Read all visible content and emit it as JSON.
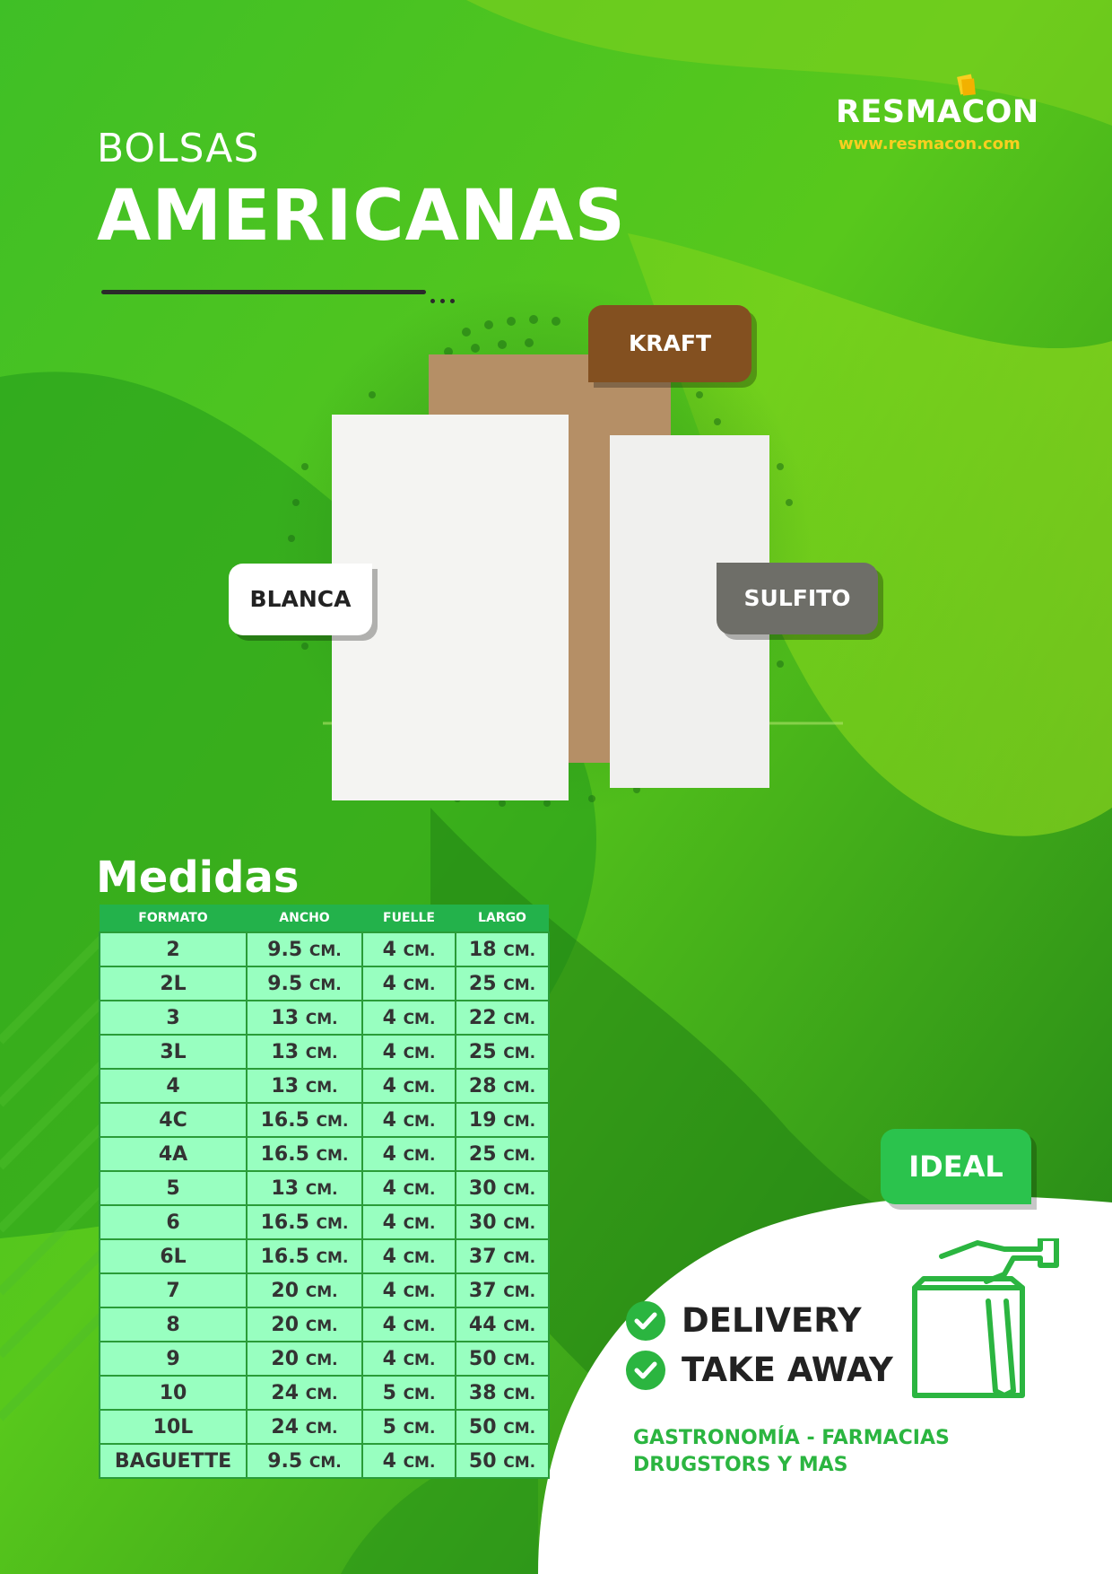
{
  "header": {
    "title_small": "BOLSAS",
    "title_big": "AMERICANAS"
  },
  "brand": {
    "name": "RESMACON",
    "url": "www.resmacon.com",
    "accent_color": "#f7cf20"
  },
  "bag_tags": {
    "kraft": "KRAFT",
    "blanca": "BLANCA",
    "sulfito": "SULFITO"
  },
  "medidas": {
    "title": "Medidas",
    "headers": [
      "FORMATO",
      "ANCHO",
      "FUELLE",
      "LARGO"
    ],
    "unit": "CM.",
    "rows": [
      {
        "formato": "2",
        "ancho": "9.5",
        "fuelle": "4",
        "largo": "18"
      },
      {
        "formato": "2L",
        "ancho": "9.5",
        "fuelle": "4",
        "largo": "25"
      },
      {
        "formato": "3",
        "ancho": "13",
        "fuelle": "4",
        "largo": "22"
      },
      {
        "formato": "3L",
        "ancho": "13",
        "fuelle": "4",
        "largo": "25"
      },
      {
        "formato": "4",
        "ancho": "13",
        "fuelle": "4",
        "largo": "28"
      },
      {
        "formato": "4C",
        "ancho": "16.5",
        "fuelle": "4",
        "largo": "19"
      },
      {
        "formato": "4A",
        "ancho": "16.5",
        "fuelle": "4",
        "largo": "25"
      },
      {
        "formato": "5",
        "ancho": "13",
        "fuelle": "4",
        "largo": "30"
      },
      {
        "formato": "6",
        "ancho": "16.5",
        "fuelle": "4",
        "largo": "30"
      },
      {
        "formato": "6L",
        "ancho": "16.5",
        "fuelle": "4",
        "largo": "37"
      },
      {
        "formato": "7",
        "ancho": "20",
        "fuelle": "4",
        "largo": "37"
      },
      {
        "formato": "8",
        "ancho": "20",
        "fuelle": "4",
        "largo": "44"
      },
      {
        "formato": "9",
        "ancho": "20",
        "fuelle": "4",
        "largo": "50"
      },
      {
        "formato": "10",
        "ancho": "24",
        "fuelle": "5",
        "largo": "38"
      },
      {
        "formato": "10L",
        "ancho": "24",
        "fuelle": "5",
        "largo": "50"
      },
      {
        "formato": "BAGUETTE",
        "ancho": "9.5",
        "fuelle": "4",
        "largo": "50"
      }
    ]
  },
  "ideal": {
    "tag": "IDEAL",
    "options": [
      "DELIVERY",
      "TAKE AWAY"
    ],
    "uses_line1": "GASTRONOMÍA - FARMACIAS",
    "uses_line2": "DRUGSTORS Y MAS",
    "icon": "bag-handover-icon",
    "accent_color": "#2bb540"
  }
}
